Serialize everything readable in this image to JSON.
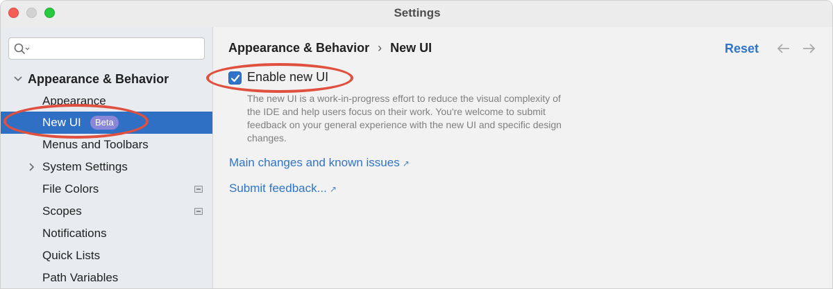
{
  "window": {
    "title": "Settings"
  },
  "search": {
    "placeholder": ""
  },
  "sidebar": {
    "group_label": "Appearance & Behavior",
    "items": [
      {
        "label": "Appearance"
      },
      {
        "label": "New UI",
        "badge": "Beta",
        "selected": true
      },
      {
        "label": "Menus and Toolbars"
      },
      {
        "label": "System Settings",
        "expandable": true
      },
      {
        "label": "File Colors",
        "project_icon": true
      },
      {
        "label": "Scopes",
        "project_icon": true
      },
      {
        "label": "Notifications"
      },
      {
        "label": "Quick Lists"
      },
      {
        "label": "Path Variables"
      }
    ]
  },
  "header": {
    "breadcrumb_parent": "Appearance & Behavior",
    "breadcrumb_separator": "›",
    "breadcrumb_current": "New UI",
    "reset_label": "Reset"
  },
  "content": {
    "checkbox_label": "Enable new UI",
    "checkbox_checked": true,
    "description": "The new UI is a work-in-progress effort to reduce the visual complexity of the IDE and help users focus on their work. You're welcome to submit feedback on your general experience with the new UI and specific design changes.",
    "link_changes": "Main changes and known issues",
    "link_feedback": "Submit feedback...",
    "external_arrow": "↗"
  },
  "colors": {
    "accent": "#2f74c9",
    "selection": "#2f6fc4",
    "badge": "#8a86d8",
    "highlight_oval": "#e0503f"
  }
}
